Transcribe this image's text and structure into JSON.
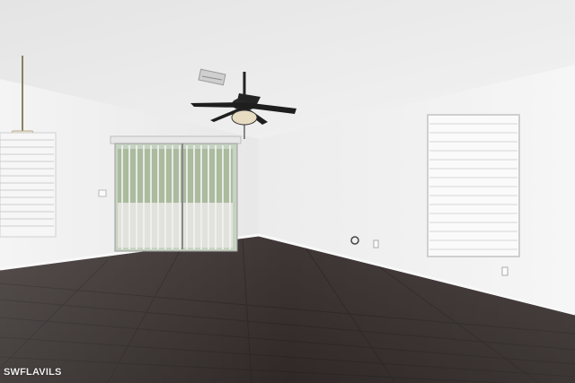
{
  "scene": {
    "description_tag": "empty-living-room-photo",
    "watermark": "SWFLAVILS"
  }
}
